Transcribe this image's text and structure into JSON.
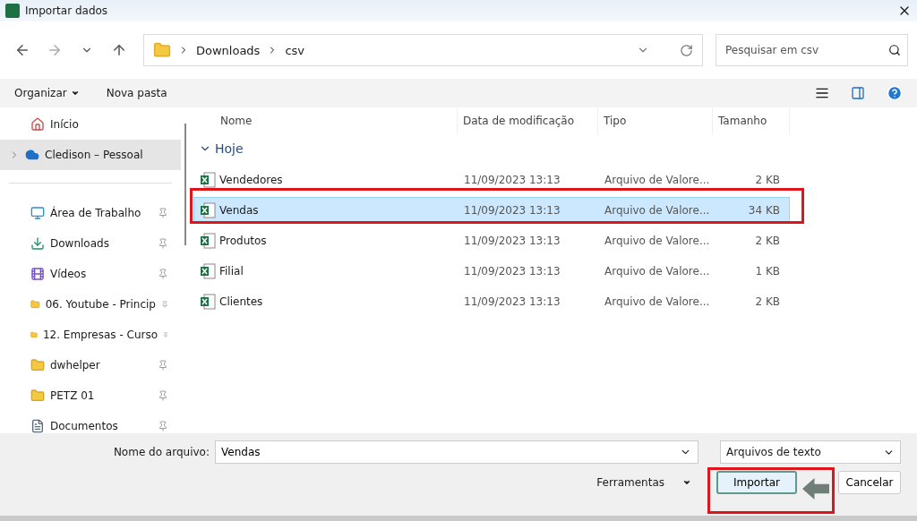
{
  "window": {
    "title": "Importar dados"
  },
  "address": {
    "path": [
      "Downloads",
      "csv"
    ]
  },
  "search": {
    "placeholder": "Pesquisar em csv"
  },
  "toolbar": {
    "organize": "Organizar",
    "new_folder": "Nova pasta"
  },
  "sidebar": {
    "items": [
      {
        "label": "Início",
        "kind": "home",
        "selected": false,
        "pinned": false
      },
      {
        "label": "Cledison – Pessoal",
        "kind": "cloud",
        "selected": true,
        "pinned": false
      },
      {
        "label": "Área de Trabalho",
        "kind": "desktop",
        "selected": false,
        "pinned": true
      },
      {
        "label": "Downloads",
        "kind": "download",
        "selected": false,
        "pinned": true
      },
      {
        "label": "Vídeos",
        "kind": "video",
        "selected": false,
        "pinned": true
      },
      {
        "label": "06. Youtube - Princip",
        "kind": "cloudfolder",
        "selected": false,
        "pinned": true
      },
      {
        "label": "12. Empresas - Curso",
        "kind": "cloudfolder",
        "selected": false,
        "pinned": true
      },
      {
        "label": "dwhelper",
        "kind": "folder",
        "selected": false,
        "pinned": true
      },
      {
        "label": "PETZ 01",
        "kind": "folder",
        "selected": false,
        "pinned": true
      },
      {
        "label": "Documentos",
        "kind": "documents",
        "selected": false,
        "pinned": true
      }
    ]
  },
  "table": {
    "columns": [
      "Nome",
      "Data de modificação",
      "Tipo",
      "Tamanho"
    ],
    "group": {
      "label": "Hoje",
      "expanded": true
    },
    "rows": [
      {
        "name": "Vendedores",
        "date": "11/09/2023 13:13",
        "type": "Arquivo de Valore...",
        "size": "2 KB",
        "selected": false
      },
      {
        "name": "Vendas",
        "date": "11/09/2023 13:13",
        "type": "Arquivo de Valore...",
        "size": "34 KB",
        "selected": true
      },
      {
        "name": "Produtos",
        "date": "11/09/2023 13:13",
        "type": "Arquivo de Valore...",
        "size": "2 KB",
        "selected": false
      },
      {
        "name": "Filial",
        "date": "11/09/2023 13:13",
        "type": "Arquivo de Valore...",
        "size": "1 KB",
        "selected": false
      },
      {
        "name": "Clientes",
        "date": "11/09/2023 13:13",
        "type": "Arquivo de Valore...",
        "size": "2 KB",
        "selected": false
      }
    ]
  },
  "footer": {
    "filename_label": "Nome do arquivo:",
    "filename_value": "Vendas",
    "filter": "Arquivos de texto",
    "tools": "Ferramentas",
    "import": "Importar",
    "cancel": "Cancelar"
  }
}
